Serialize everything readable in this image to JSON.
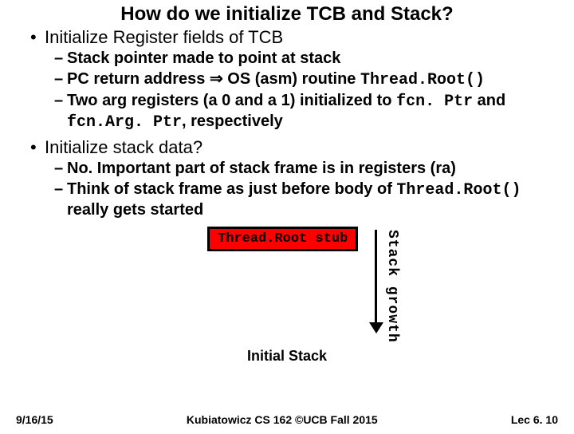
{
  "title": "How do we initialize TCB and Stack?",
  "bullets": {
    "b1": "Initialize Register fields of TCB",
    "b1a": "Stack pointer made to point at stack",
    "b1b_pre": "PC return address ",
    "b1b_arrow": "⇒",
    "b1b_post": " OS (asm) routine ",
    "b1b_code": "Thread.Root()",
    "b1c_pre": "Two arg registers (a 0 and a 1) initialized to ",
    "b1c_code1": "fcn. Ptr",
    "b1c_mid": " and ",
    "b1c_code2": "fcn.Arg. Ptr",
    "b1c_post": ", respectively",
    "b2": "Initialize stack data?",
    "b2a": "No. Important part of stack frame is in registers (ra)",
    "b2b_pre": "Think of stack frame as just before body of ",
    "b2b_code": "Thread.Root()",
    "b2b_post": " really gets started"
  },
  "diagram": {
    "box": "Thread.Root stub",
    "vlabel": "Stack growth",
    "caption": "Initial Stack"
  },
  "footer": {
    "left": "9/16/15",
    "center": "Kubiatowicz CS 162 ©UCB Fall 2015",
    "right": "Lec 6. 10"
  }
}
